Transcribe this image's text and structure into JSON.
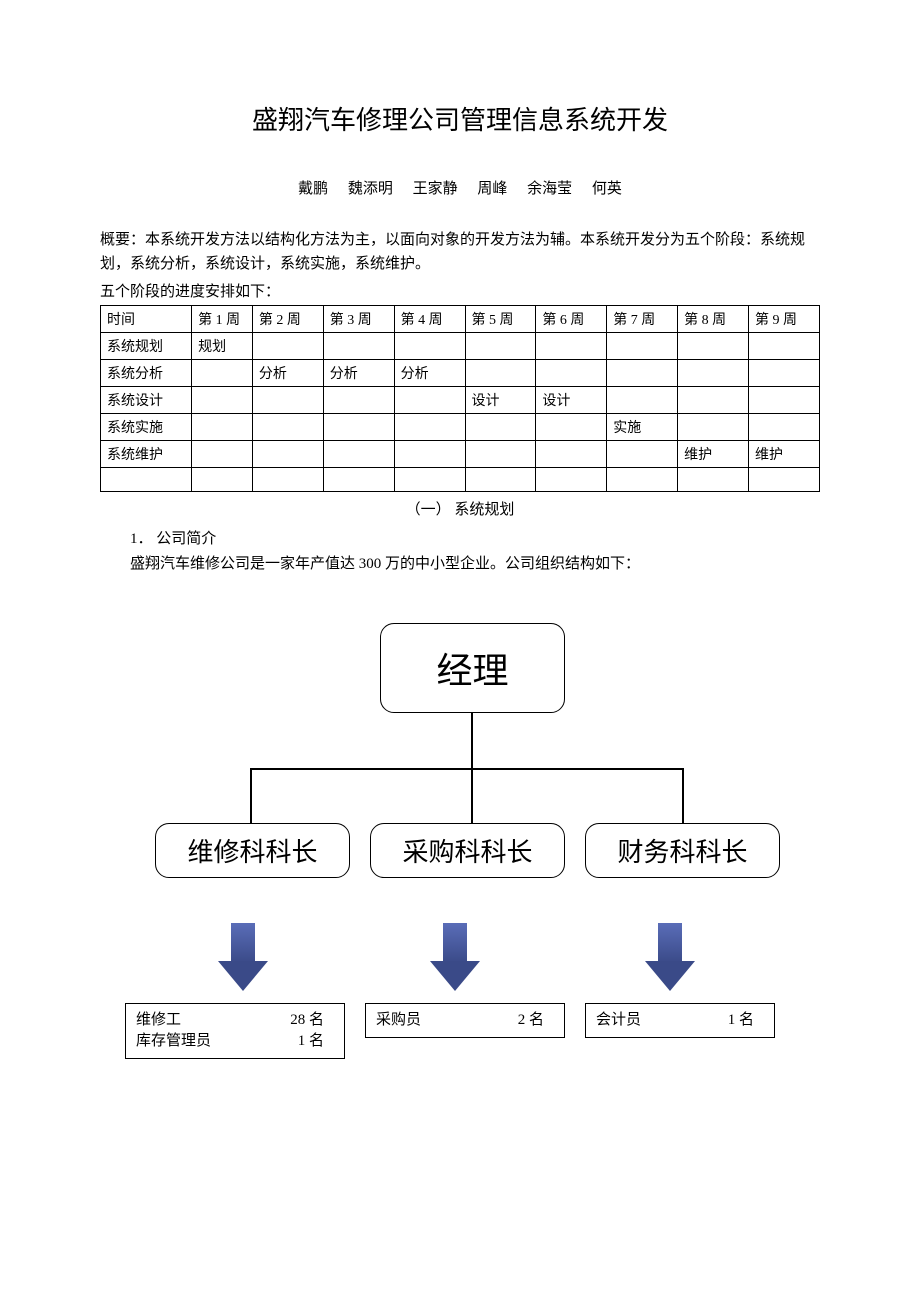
{
  "title": "盛翔汽车修理公司管理信息系统开发",
  "authors": [
    "戴鹏",
    "魏添明",
    "王家静",
    "周峰",
    "余海莹",
    "何英"
  ],
  "summary": "概要：本系统开发方法以结构化方法为主，以面向对象的开发方法为辅。本系统开发分为五个阶段：系统规划，系统分析，系统设计，系统实施，系统维护。",
  "scheduleLabel": "五个阶段的进度安排如下：",
  "scheduleHeader": {
    "timeLabel": "时间",
    "weeks": [
      "第 1 周",
      "第 2 周",
      "第 3 周",
      "第 4 周",
      "第 5 周",
      "第 6 周",
      "第 7 周",
      "第 8 周",
      "第 9 周"
    ]
  },
  "scheduleRows": [
    {
      "label": "系统规划",
      "cells": [
        "规划",
        "",
        "",
        "",
        "",
        "",
        "",
        "",
        ""
      ]
    },
    {
      "label": "系统分析",
      "cells": [
        "",
        "分析",
        "分析",
        "分析",
        "",
        "",
        "",
        "",
        ""
      ]
    },
    {
      "label": "系统设计",
      "cells": [
        "",
        "",
        "",
        "",
        "设计",
        "设计",
        "",
        "",
        ""
      ]
    },
    {
      "label": "系统实施",
      "cells": [
        "",
        "",
        "",
        "",
        "",
        "",
        "实施",
        "",
        ""
      ]
    },
    {
      "label": "系统维护",
      "cells": [
        "",
        "",
        "",
        "",
        "",
        "",
        "",
        "维护",
        "维护"
      ]
    },
    {
      "label": "",
      "cells": [
        "",
        "",
        "",
        "",
        "",
        "",
        "",
        "",
        ""
      ]
    }
  ],
  "sectionHeader": "（一）  系统规划",
  "subsection": "1．  公司简介",
  "companyIntro": "盛翔汽车维修公司是一家年产值达 300 万的中小型企业。公司组织结构如下：",
  "org": {
    "top": "经理",
    "mid": [
      "维修科科长",
      "采购科科长",
      "财务科科长"
    ],
    "boxes": [
      [
        {
          "role": "维修工",
          "count": "28 名"
        },
        {
          "role": "库存管理员",
          "count": "1 名"
        }
      ],
      [
        {
          "role": "采购员",
          "count": "2 名"
        }
      ],
      [
        {
          "role": "会计员",
          "count": "1 名"
        }
      ]
    ]
  }
}
